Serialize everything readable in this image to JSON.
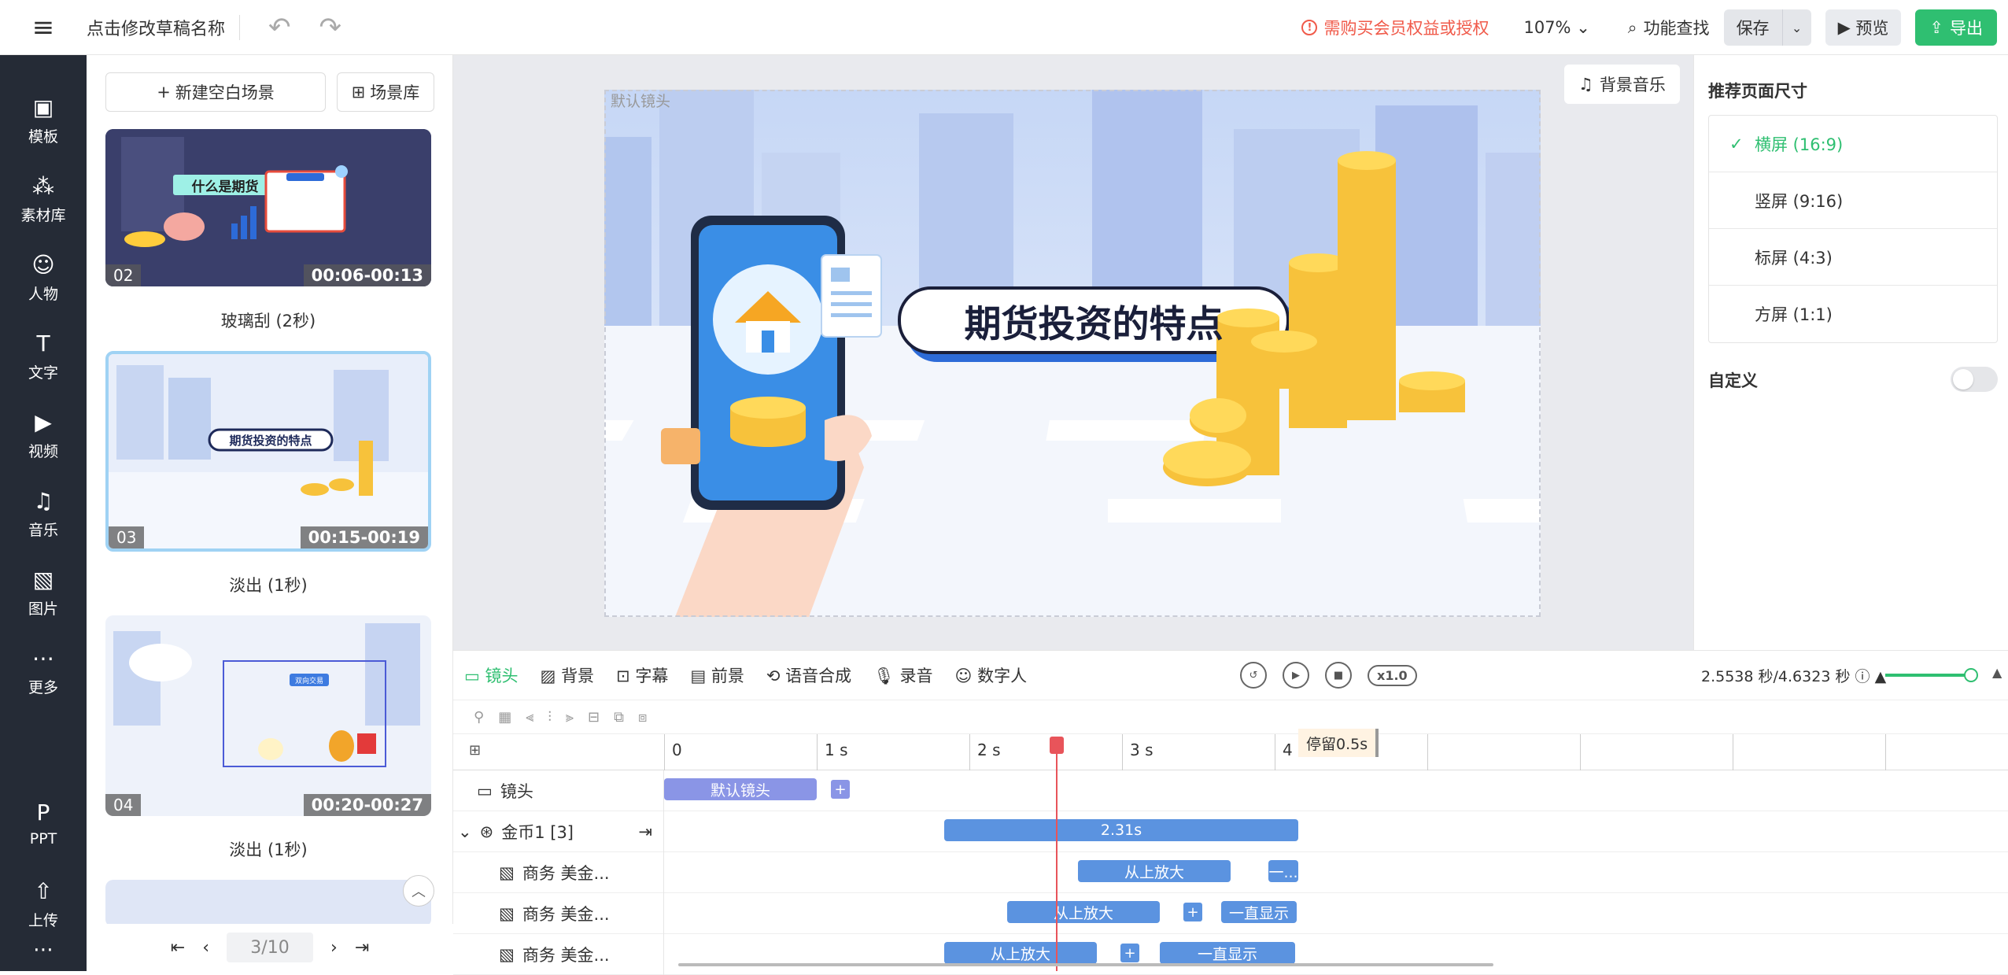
{
  "topbar": {
    "draft_name": "点击修改草稿名称",
    "warning": "需购买会员权益或授权",
    "zoom": "107%",
    "func_search": "功能查找",
    "save": "保存",
    "preview": "预览",
    "export": "导出"
  },
  "sidebar": {
    "items": [
      {
        "label": "模板",
        "icon": "template-icon"
      },
      {
        "label": "素材库",
        "icon": "material-icon"
      },
      {
        "label": "人物",
        "icon": "person-icon"
      },
      {
        "label": "文字",
        "icon": "text-icon"
      },
      {
        "label": "视频",
        "icon": "video-icon"
      },
      {
        "label": "音乐",
        "icon": "music-icon"
      },
      {
        "label": "图片",
        "icon": "image-icon"
      },
      {
        "label": "更多",
        "icon": "more-icon"
      },
      {
        "label": "PPT",
        "icon": "ppt-icon"
      },
      {
        "label": "上传",
        "icon": "upload-icon"
      }
    ]
  },
  "scenes": {
    "new_blank": "新建空白场景",
    "library": "场景库",
    "thumb2_title": "什么是期货",
    "thumb3_title": "期货投资的特点",
    "thumb4_title": "双向交易",
    "items": [
      {
        "num": "02",
        "time": "00:06-00:13",
        "transition": "玻璃刮 (2秒)"
      },
      {
        "num": "03",
        "time": "00:15-00:19",
        "transition": "淡出 (1秒)"
      },
      {
        "num": "04",
        "time": "00:20-00:27",
        "transition": "淡出 (1秒)"
      }
    ],
    "page": "3/10"
  },
  "canvas": {
    "default_lens": "默认镜头",
    "bg_music": "背景音乐",
    "title": "期货投资的特点"
  },
  "right_panel": {
    "title": "推荐页面尺寸",
    "options": [
      "横屏 (16:9)",
      "竖屏 (9:16)",
      "标屏 (4:3)",
      "方屏 (1:1)"
    ],
    "custom": "自定义"
  },
  "timeline": {
    "tabs": [
      "镜头",
      "背景",
      "字幕",
      "前景",
      "语音合成",
      "录音",
      "数字人"
    ],
    "speed": "x1.0",
    "time_info": "2.5538 秒/4.6323 秒",
    "ticks": [
      "0",
      "1 s",
      "2 s",
      "3 s",
      "4 s"
    ],
    "dwell": "停留0.5s",
    "rows": [
      {
        "label": "镜头",
        "bars": [
          "默认镜头"
        ]
      },
      {
        "label": "金币1 [3]",
        "bars": [
          "2.31s"
        ]
      },
      {
        "label": "商务 美金...",
        "bars": [
          "从上放大",
          "一..."
        ]
      },
      {
        "label": "商务 美金...",
        "bars": [
          "从上放大",
          "一直显示"
        ]
      },
      {
        "label": "商务 美金...",
        "bars": [
          "从上放大",
          "一直显示"
        ]
      }
    ]
  }
}
